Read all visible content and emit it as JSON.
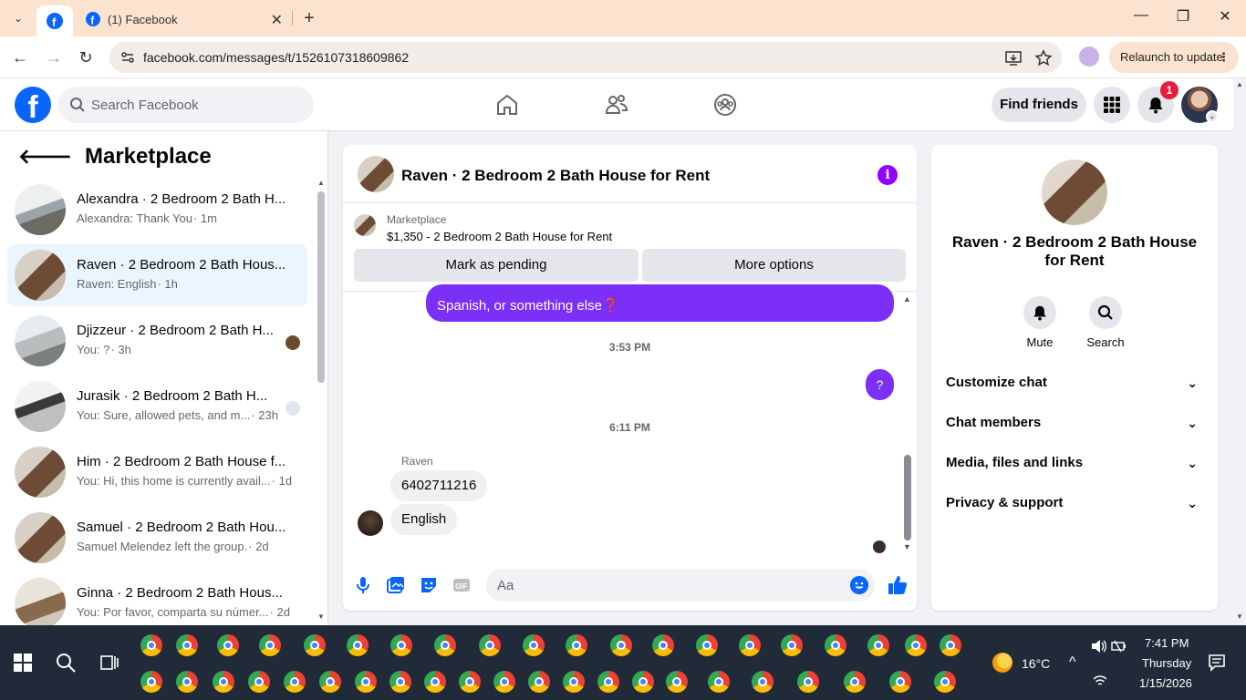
{
  "browser": {
    "tab_title": "(1) Facebook",
    "url": "facebook.com/messages/t/1526107318609862",
    "relaunch_label": "Relaunch to update"
  },
  "header": {
    "search_placeholder": "Search Facebook",
    "find_friends_label": "Find friends",
    "notification_count": "1"
  },
  "left_panel": {
    "title": "Marketplace",
    "conversations": [
      {
        "name": "Alexandra · 2 Bedroom 2 Bath H...",
        "preview": "Alexandra: Thank You",
        "time": "· 1m",
        "active": false,
        "mini": false
      },
      {
        "name": "Raven · 2 Bedroom 2 Bath Hous...",
        "preview": "Raven: English",
        "time": "· 1h",
        "active": true,
        "mini": false
      },
      {
        "name": "Djizzeur · 2 Bedroom 2 Bath H...",
        "preview": "You: ?",
        "time": "· 3h",
        "active": false,
        "mini": true
      },
      {
        "name": "Jurasik · 2 Bedroom 2 Bath H...",
        "preview": "You: Sure, allowed pets, and m...",
        "time": "· 23h",
        "active": false,
        "mini": true
      },
      {
        "name": "Him · 2 Bedroom 2 Bath House f...",
        "preview": "You: Hi, this home is currently avail...",
        "time": "· 1d",
        "active": false,
        "mini": false
      },
      {
        "name": "Samuel · 2 Bedroom 2 Bath Hou...",
        "preview": "Samuel Melendez left the group.",
        "time": "· 2d",
        "active": false,
        "mini": false
      },
      {
        "name": "Ginna · 2 Bedroom 2 Bath Hous...",
        "preview": "You: Por favor, comparta su númer...",
        "time": "· 2d",
        "active": false,
        "mini": false
      }
    ]
  },
  "chat": {
    "title": "Raven · 2 Bedroom 2 Bath House for Rent",
    "card_label": "Marketplace",
    "card_price": "$1,350 - 2 Bedroom 2 Bath House for Rent",
    "pending_label": "Mark as pending",
    "more_label": "More options",
    "last_out_message": "Spanish, or something else❓",
    "ts1": "3:53 PM",
    "question_message": "?",
    "ts2": "6:11 PM",
    "sender": "Raven",
    "in_msg1": "6402711216",
    "in_msg2": "English",
    "composer_placeholder": "Aa"
  },
  "right_panel": {
    "title": "Raven · 2 Bedroom 2 Bath House for Rent",
    "mute_label": "Mute",
    "search_label": "Search",
    "rows": [
      "Customize chat",
      "Chat members",
      "Media, files and links",
      "Privacy & support"
    ]
  },
  "taskbar": {
    "weather": "16°C",
    "time": "7:41 PM",
    "day": "Thursday",
    "date": "1/15/2026"
  },
  "colors": {
    "fb_blue": "#0866ff",
    "messenger_purple": "#7b2ff7",
    "active_row": "#ebf5ff"
  }
}
